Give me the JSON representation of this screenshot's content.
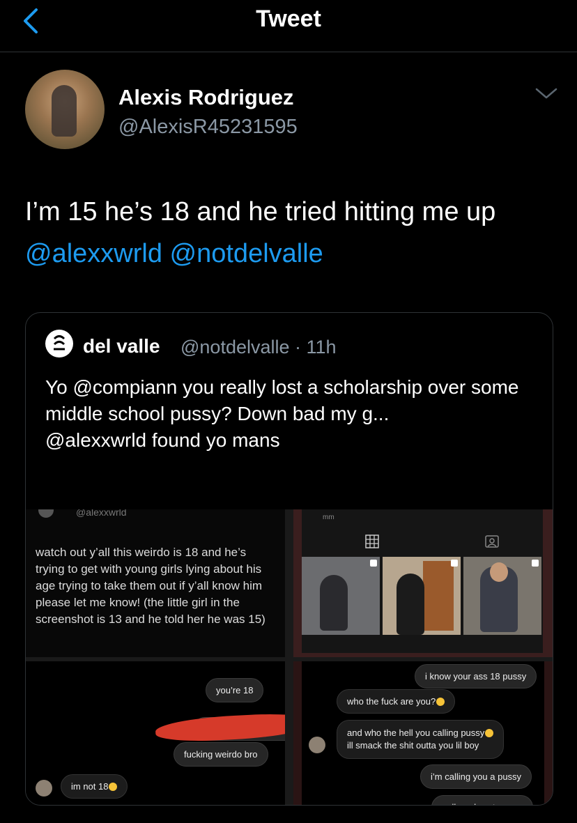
{
  "header": {
    "title": "Tweet"
  },
  "tweet": {
    "author_name": "Alexis Rodriguez",
    "author_handle": "@AlexisR45231595",
    "text_before": "I’m 15 he’s 18 and he tried hitting me up ",
    "mention1": "@alexxwrld",
    "mention2": "@notdelvalle"
  },
  "quote": {
    "author_name": "del valle",
    "author_handle": "@notdelvalle · 11h",
    "line1": "Yo @compiann you really lost a scholarship over some middle school pussy? Down bad my g...",
    "line2": "@alexxwrld found yo mans"
  },
  "media": {
    "cell1_handle": "@alexxwrld",
    "cell1_text": "watch out y’all this weirdo is 18 and he’s trying to get with young girls lying about his age trying to take them out if y’all know him please let me know! (the little girl in the screenshot is 13 and he told her he was 15)",
    "cell2_label": "mm",
    "cell3": {
      "msg1": "you’re 18",
      "msg2": "fucking weirdo bro",
      "msg3": "im not 18"
    },
    "cell4": {
      "msg1": "i know your ass 18 pussy",
      "msg2": "who the fuck are you?",
      "msg3a": "and who the hell you calling pussy",
      "msg3b": "ill smack the shit outta you lil boy",
      "msg4": "i’m calling you a pussy",
      "msg5": "pull up downtown rn"
    }
  },
  "colors": {
    "link": "#1d9bf0",
    "secondary_text": "#8b98a5",
    "background": "#000000"
  },
  "icons": [
    "back-icon",
    "chevron-down-icon",
    "grid-icon",
    "tagged-icon"
  ]
}
